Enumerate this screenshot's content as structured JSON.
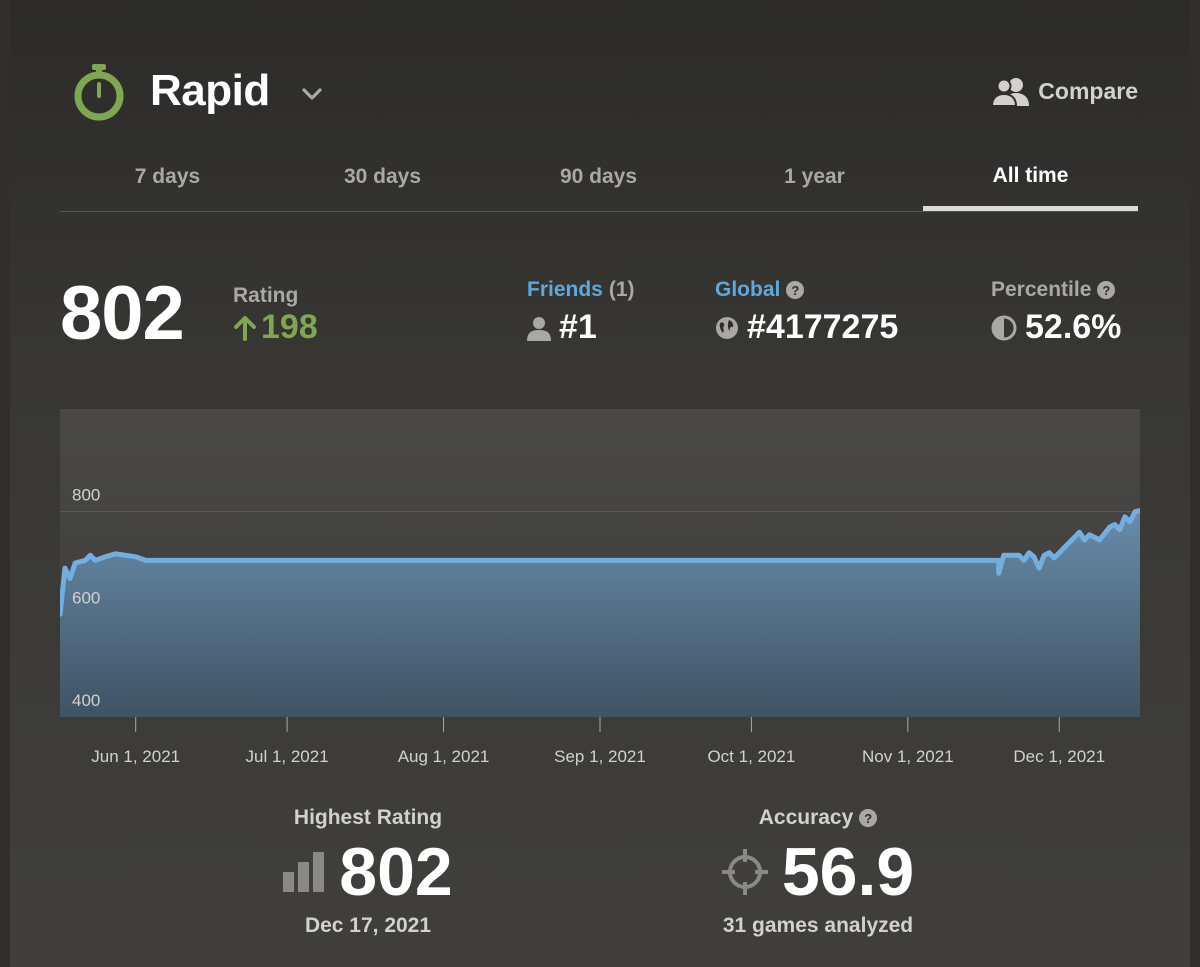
{
  "header": {
    "mode_title": "Rapid",
    "mode_icon": "stopwatch-icon",
    "compare_label": "Compare",
    "compare_icon": "users-icon"
  },
  "tabs": [
    {
      "label": "7 days",
      "active": false
    },
    {
      "label": "30 days",
      "active": false
    },
    {
      "label": "90 days",
      "active": false
    },
    {
      "label": "1 year",
      "active": false
    },
    {
      "label": "All time",
      "active": true
    }
  ],
  "stats": {
    "rating": "802",
    "rating_label": "Rating",
    "rating_change": "198",
    "friends_label": "Friends",
    "friends_count": "(1)",
    "friends_rank": "#1",
    "global_label": "Global",
    "global_rank": "#4177275",
    "percentile_label": "Percentile",
    "percentile_value": "52.6%"
  },
  "summary": {
    "highest_label": "Highest Rating",
    "highest_value": "802",
    "highest_date": "Dec 17, 2021",
    "accuracy_label": "Accuracy",
    "accuracy_value": "56.9",
    "accuracy_sub": "31 games analyzed"
  },
  "colors": {
    "accent_green": "#7fa650",
    "link_blue": "#5fa8db",
    "line_blue": "#73aee0"
  },
  "chart_data": {
    "type": "area",
    "title": "",
    "xlabel": "",
    "ylabel": "",
    "ylim": [
      400,
      1000
    ],
    "yticks": [
      400,
      600,
      800
    ],
    "xlim": [
      "2021-05-17",
      "2021-12-17"
    ],
    "xticks": [
      {
        "date": "2021-06-01",
        "label": "Jun 1, 2021"
      },
      {
        "date": "2021-07-01",
        "label": "Jul 1, 2021"
      },
      {
        "date": "2021-08-01",
        "label": "Aug 1, 2021"
      },
      {
        "date": "2021-09-01",
        "label": "Sep 1, 2021"
      },
      {
        "date": "2021-10-01",
        "label": "Oct 1, 2021"
      },
      {
        "date": "2021-11-01",
        "label": "Nov 1, 2021"
      },
      {
        "date": "2021-12-01",
        "label": "Dec 1, 2021"
      }
    ],
    "grid": true,
    "series": [
      {
        "points": [
          [
            "2021-05-17",
            600
          ],
          [
            "2021-05-18",
            690
          ],
          [
            "2021-05-19",
            670
          ],
          [
            "2021-05-20",
            700
          ],
          [
            "2021-05-22",
            705
          ],
          [
            "2021-05-23",
            715
          ],
          [
            "2021-05-24",
            705
          ],
          [
            "2021-05-26",
            712
          ],
          [
            "2021-05-28",
            718
          ],
          [
            "2021-06-01",
            712
          ],
          [
            "2021-06-03",
            705
          ],
          [
            "2021-07-01",
            705
          ],
          [
            "2021-09-01",
            705
          ],
          [
            "2021-11-19",
            705
          ],
          [
            "2021-11-19",
            680
          ],
          [
            "2021-11-20",
            715
          ],
          [
            "2021-11-23",
            715
          ],
          [
            "2021-11-24",
            705
          ],
          [
            "2021-11-25",
            720
          ],
          [
            "2021-11-26",
            712
          ],
          [
            "2021-11-27",
            690
          ],
          [
            "2021-11-28",
            715
          ],
          [
            "2021-11-29",
            720
          ],
          [
            "2021-11-30",
            710
          ],
          [
            "2021-12-01",
            720
          ],
          [
            "2021-12-03",
            740
          ],
          [
            "2021-12-05",
            760
          ],
          [
            "2021-12-06",
            745
          ],
          [
            "2021-12-07",
            755
          ],
          [
            "2021-12-08",
            750
          ],
          [
            "2021-12-09",
            745
          ],
          [
            "2021-12-11",
            770
          ],
          [
            "2021-12-12",
            775
          ],
          [
            "2021-12-13",
            765
          ],
          [
            "2021-12-14",
            790
          ],
          [
            "2021-12-15",
            780
          ],
          [
            "2021-12-16",
            800
          ],
          [
            "2021-12-17",
            802
          ]
        ]
      }
    ]
  }
}
